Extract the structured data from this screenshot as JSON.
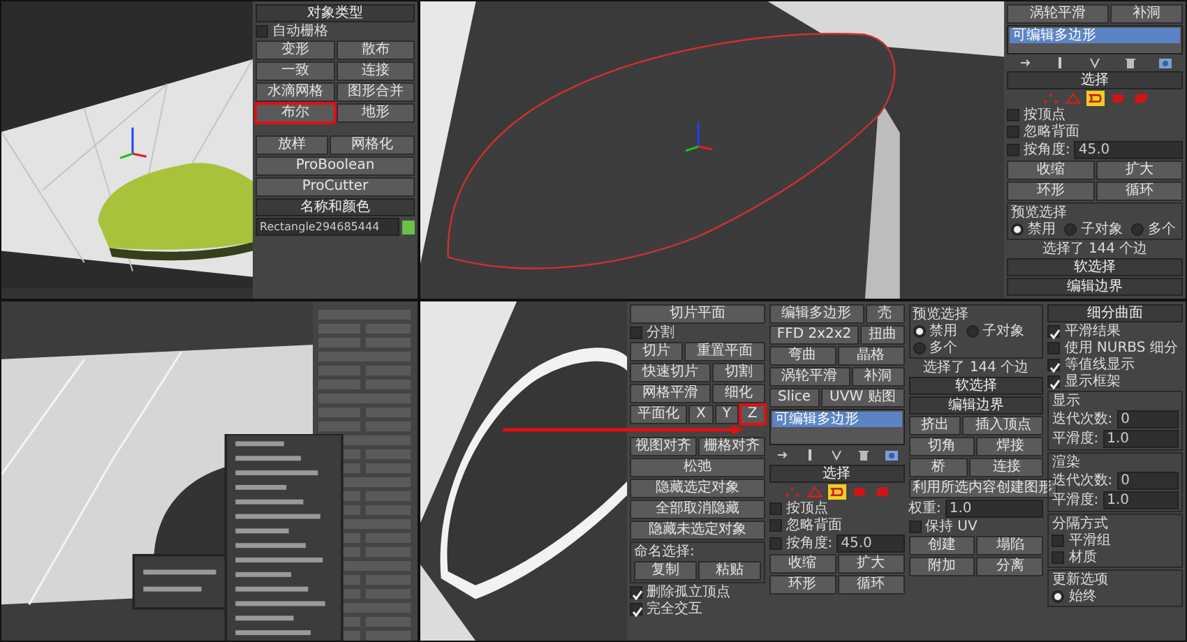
{
  "panels": [
    {
      "columns": [
        {
          "items": [
            {
              "kind": "header",
              "text": "对象类型"
            },
            {
              "kind": "check",
              "label": "自动栅格",
              "checked": false
            },
            {
              "kind": "buttons",
              "buttons": [
                "变形",
                "散布"
              ]
            },
            {
              "kind": "buttons",
              "buttons": [
                "一致",
                "连接"
              ]
            },
            {
              "kind": "buttons",
              "buttons": [
                "水滴网格",
                "图形合并"
              ]
            },
            {
              "kind": "buttons",
              "buttons": [
                {
                  "label": "布尔",
                  "highlighted": true
                },
                {
                  "label": "地形",
                  "highlighted": false
                }
              ]
            },
            {
              "kind": "buttons",
              "buttons": [
                "放样",
                "网格化"
              ]
            },
            {
              "kind": "buttons",
              "buttons": [
                "ProBoolean",
                "ProCutter"
              ]
            },
            {
              "kind": "header",
              "text": "名称和颜色"
            },
            {
              "kind": "field",
              "value": "Rectangle294685444"
            }
          ]
        }
      ]
    },
    {
      "columns": [
        {
          "items": [
            {
              "kind": "buttons",
              "buttons": [
                "涡轮平滑",
                "补洞"
              ]
            },
            {
              "kind": "stack",
              "items": [
                {
                  "label": "可编辑多边形",
                  "selected": true
                }
              ]
            },
            {
              "kind": "toolbar"
            },
            {
              "kind": "header",
              "text": "选择"
            },
            {
              "kind": "subobjects",
              "options": [
                {
                  "selected": false
                },
                {
                  "selected": false
                },
                {
                  "selected": true
                },
                {
                  "selected": false
                },
                {
                  "selected": false
                }
              ]
            },
            {
              "kind": "check",
              "label": "按顶点",
              "checked": false
            },
            {
              "kind": "check",
              "label": "忽略背面",
              "checked": false
            },
            {
              "kind": "check",
              "label": "按角度:",
              "checked": false,
              "value": "45.0"
            },
            {
              "kind": "buttons",
              "buttons": [
                "收缩",
                "扩大"
              ]
            },
            {
              "kind": "buttons",
              "buttons": [
                "环形",
                "循环"
              ]
            },
            {
              "kind": "group",
              "title": "预览选择",
              "items": [
                {
                  "kind": "radios",
                  "options": [
                    {
                      "label": "禁用",
                      "selected": true
                    },
                    {
                      "label": "子对象",
                      "selected": false
                    },
                    {
                      "label": "多个",
                      "selected": false
                    }
                  ]
                }
              ]
            },
            {
              "kind": "text",
              "text": "选择了 144 个边"
            },
            {
              "kind": "header",
              "text": "软选择"
            },
            {
              "kind": "header",
              "text": "编辑边界"
            }
          ]
        }
      ]
    },
    {
      "columns": [
        {
          "items": [
            {
              "kind": "buttons",
              "buttons": [
                "切片平面"
              ]
            },
            {
              "kind": "check",
              "label": "分割",
              "checked": false
            },
            {
              "kind": "buttons",
              "buttons": [
                "切片",
                "重置平面"
              ]
            },
            {
              "kind": "buttons",
              "buttons": [
                "快速切片",
                "切割"
              ]
            },
            {
              "kind": "buttons",
              "buttons": [
                "网格平滑",
                "细化"
              ]
            },
            {
              "kind": "buttons",
              "buttons": [
                {
                  "label": "平面化",
                  "highlighted": false
                },
                {
                  "label": "X",
                  "highlighted": false
                },
                {
                  "label": "Y",
                  "highlighted": false
                },
                {
                  "label": "Z",
                  "highlighted": true
                }
              ]
            },
            {
              "kind": "buttons",
              "buttons": [
                "视图对齐",
                "栅格对齐"
              ]
            },
            {
              "kind": "buttons",
              "buttons": [
                "松弛"
              ]
            },
            {
              "kind": "buttons",
              "buttons": [
                "隐藏选定对象",
                "全部取消隐藏"
              ]
            },
            {
              "kind": "buttons",
              "buttons": [
                "隐藏未选定对象"
              ]
            },
            {
              "kind": "group",
              "title": "命名选择:",
              "items": [
                {
                  "kind": "buttons",
                  "buttons": [
                    "复制",
                    "粘贴"
                  ]
                }
              ]
            },
            {
              "kind": "check",
              "label": "删除孤立顶点",
              "checked": true
            },
            {
              "kind": "check",
              "label": "完全交互",
              "checked": true
            }
          ]
        },
        {
          "items": [
            {
              "kind": "buttons",
              "buttons": [
                "编辑多边形",
                "壳"
              ]
            },
            {
              "kind": "buttons",
              "buttons": [
                "FFD 2x2x2",
                "扭曲"
              ]
            },
            {
              "kind": "buttons",
              "buttons": [
                "弯曲",
                "晶格"
              ]
            },
            {
              "kind": "buttons",
              "buttons": [
                "涡轮平滑",
                "补洞"
              ]
            },
            {
              "kind": "buttons",
              "buttons": [
                "Slice",
                "UVW 贴图"
              ]
            },
            {
              "kind": "stack",
              "items": [
                {
                  "label": "可编辑多边形",
                  "selected": true
                }
              ]
            },
            {
              "kind": "toolbar"
            },
            {
              "kind": "header",
              "text": "选择"
            },
            {
              "kind": "subobjects",
              "options": [
                {
                  "selected": false
                },
                {
                  "selected": false
                },
                {
                  "selected": true
                },
                {
                  "selected": false
                },
                {
                  "selected": false
                }
              ]
            },
            {
              "kind": "check",
              "label": "按顶点",
              "checked": false
            },
            {
              "kind": "check",
              "label": "忽略背面",
              "checked": false
            },
            {
              "kind": "check",
              "label": "按角度:",
              "checked": false,
              "value": "45.0"
            },
            {
              "kind": "buttons",
              "buttons": [
                "收缩",
                "扩大"
              ]
            },
            {
              "kind": "buttons",
              "buttons": [
                "环形",
                "循环"
              ]
            }
          ]
        },
        {
          "items": [
            {
              "kind": "group",
              "title": "预览选择",
              "items": [
                {
                  "kind": "radios",
                  "options": [
                    {
                      "label": "禁用",
                      "selected": true
                    },
                    {
                      "label": "子对象",
                      "selected": false
                    },
                    {
                      "label": "多个",
                      "selected": false
                    }
                  ]
                }
              ]
            },
            {
              "kind": "text",
              "text": "选择了 144 个边"
            },
            {
              "kind": "header",
              "text": "软选择"
            },
            {
              "kind": "header",
              "text": "编辑边界"
            },
            {
              "kind": "buttons",
              "buttons": [
                "挤出",
                "插入顶点"
              ]
            },
            {
              "kind": "buttons",
              "buttons": [
                "切角",
                "焊接"
              ]
            },
            {
              "kind": "buttons",
              "buttons": [
                "桥",
                "连接"
              ]
            },
            {
              "kind": "buttons",
              "buttons": [
                "利用所选内容创建图形"
              ]
            },
            {
              "kind": "spinner",
              "label": "权重:",
              "value": "1.0"
            },
            {
              "kind": "check",
              "label": "保持 UV",
              "checked": false
            },
            {
              "kind": "buttons",
              "buttons": [
                "创建",
                "塌陷"
              ]
            },
            {
              "kind": "buttons",
              "buttons": [
                "附加",
                "分离"
              ]
            }
          ]
        },
        {
          "items": [
            {
              "kind": "header",
              "text": "细分曲面"
            },
            {
              "kind": "check",
              "label": "平滑结果",
              "checked": true
            },
            {
              "kind": "check",
              "label": "使用 NURBS 细分",
              "checked": false
            },
            {
              "kind": "check",
              "label": "等值线显示",
              "checked": true
            },
            {
              "kind": "check",
              "label": "显示框架",
              "checked": true
            },
            {
              "kind": "group",
              "title": "显示",
              "items": [
                {
                  "kind": "spinner",
                  "label": "迭代次数:",
                  "value": "0"
                },
                {
                  "kind": "spinner",
                  "label": "平滑度:",
                  "value": "1.0"
                }
              ]
            },
            {
              "kind": "group",
              "title": "渲染",
              "items": [
                {
                  "kind": "spinner",
                  "label": "迭代次数:",
                  "value": "0"
                },
                {
                  "kind": "spinner",
                  "label": "平滑度:",
                  "value": "1.0"
                }
              ]
            },
            {
              "kind": "group",
              "title": "分隔方式",
              "items": [
                {
                  "kind": "check",
                  "label": "平滑组",
                  "checked": false
                },
                {
                  "kind": "check",
                  "label": "材质",
                  "checked": false
                }
              ]
            },
            {
              "kind": "group",
              "title": "更新选项",
              "items": [
                {
                  "kind": "radios",
                  "options": [
                    {
                      "label": "始终",
                      "selected": true
                    }
                  ]
                }
              ]
            }
          ]
        }
      ]
    }
  ]
}
